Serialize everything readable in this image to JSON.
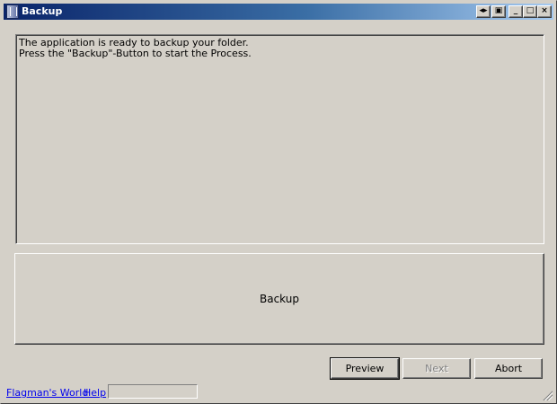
{
  "window": {
    "title": "Backup",
    "controls": [
      "◂▸",
      "▣",
      "_",
      "□",
      "×"
    ]
  },
  "content": {
    "line1": "The application is ready to backup your folder.",
    "line2": "Press the \"Backup\"-Button to start the Process."
  },
  "main_button": {
    "label": "Backup"
  },
  "buttons": {
    "preview": "Preview",
    "next": "Next",
    "abort": "Abort"
  },
  "status": {
    "link1": "Flagman's World",
    "link2": "Help",
    "field": ""
  }
}
